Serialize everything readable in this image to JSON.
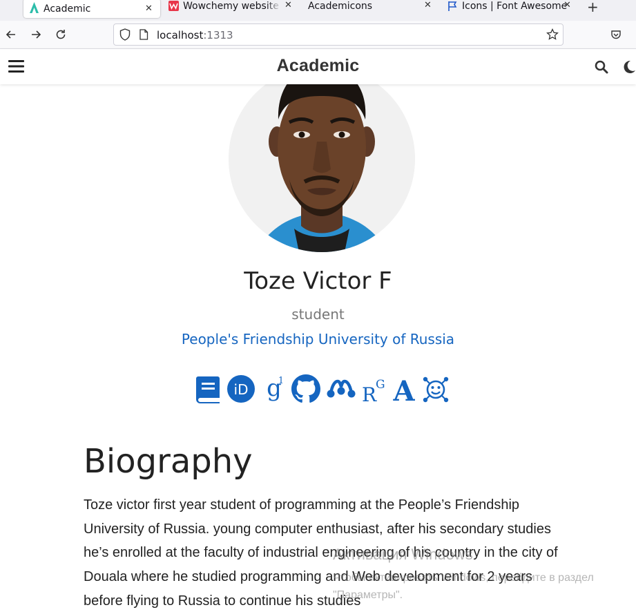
{
  "browser": {
    "tabs": [
      {
        "label": "Academic",
        "icon": "academic-logo-icon"
      },
      {
        "label": "Wowchemy website b",
        "icon": "wowchemy-logo-icon"
      },
      {
        "label": "Academicons",
        "icon": ""
      },
      {
        "label": "Icons | Font Awesome",
        "icon": "flag-icon"
      }
    ],
    "url_host": "localhost",
    "url_port": ":1313"
  },
  "site": {
    "brand": "Academic"
  },
  "profile": {
    "name": "Toze Victor F",
    "role": "student",
    "organization": "People's Friendship University of Russia",
    "social_icons": [
      "book-icon",
      "orcid-icon",
      "google-scholar-icon",
      "github-icon",
      "mendeley-icon",
      "researchgate-icon",
      "academia-icon",
      "semantic-scholar-icon"
    ]
  },
  "biography": {
    "heading": "Biography",
    "text": "Toze victor first year student of programming at the People’s Friendship University of Russia. young computer enthusiast, after his secondary studies he’s enrolled at the faculty of industrial engineering of his country in the city of Douala where he studied programming and Web development for 2 years before flying to Russia to continue his studies"
  },
  "watermark": {
    "title": "Активация Windows",
    "subtitle": "Чтобы активировать Windows, перейдите в раздел \"Параметры\"."
  },
  "colors": {
    "accent": "#1565c0",
    "text": "#222222",
    "muted": "#777777"
  }
}
